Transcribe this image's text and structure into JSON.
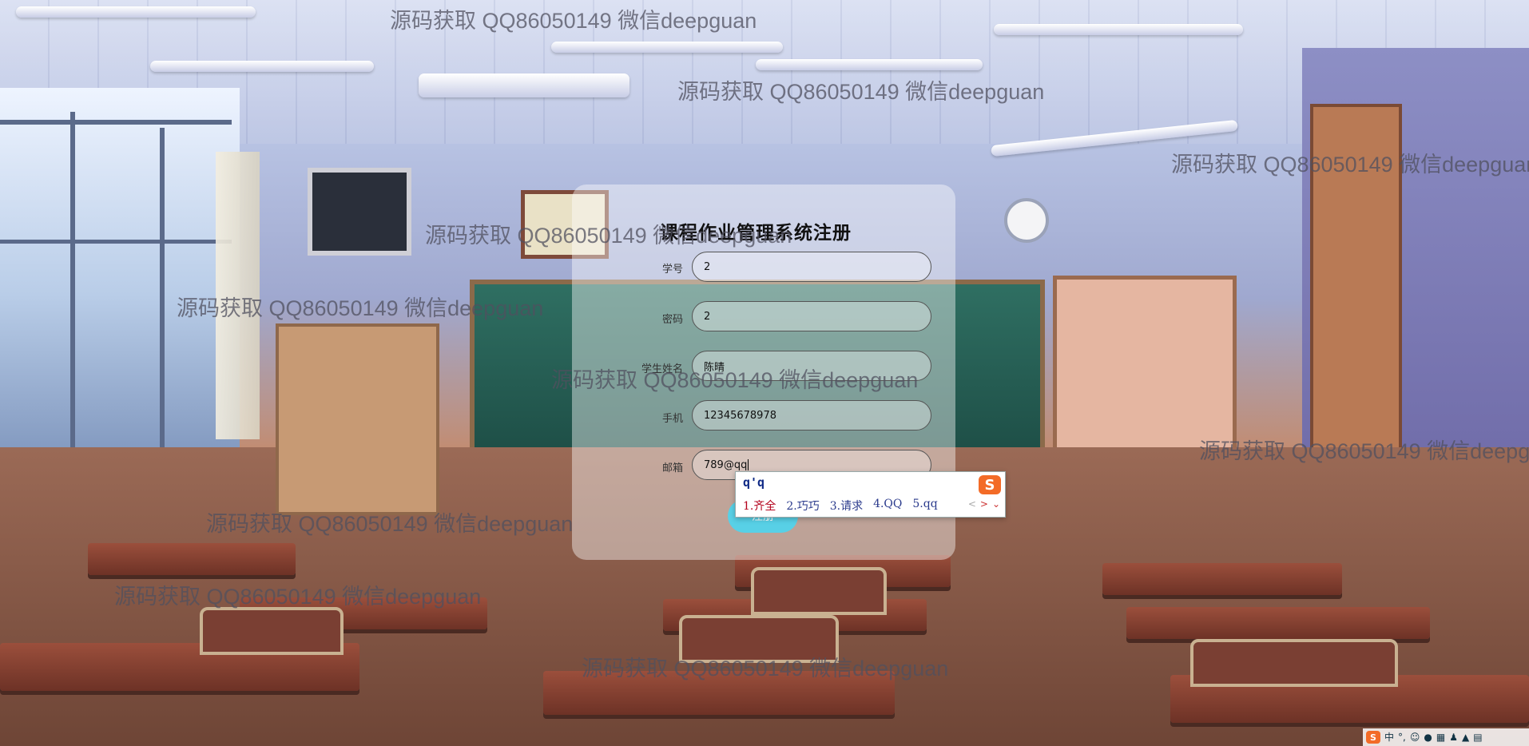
{
  "form": {
    "title": "课程作业管理系统注册",
    "fields": [
      {
        "label": "学号",
        "value": "2"
      },
      {
        "label": "密码",
        "value": "2"
      },
      {
        "label": "学生姓名",
        "value": "陈晴"
      },
      {
        "label": "手机",
        "value": "12345678978"
      },
      {
        "label": "邮箱",
        "value": "789@qq"
      }
    ],
    "submit_label": "注册"
  },
  "ime": {
    "composition": "q'q",
    "candidates": [
      "1.齐全",
      "2.巧巧",
      "3.请求",
      "4.QQ",
      "5.qq"
    ],
    "nav": [
      "<",
      ">",
      "⌄"
    ],
    "logo": "S"
  },
  "watermark": {
    "text": "源码获取 QQ86050149 微信deepguan"
  },
  "tray": {
    "logo": "S",
    "lang": "中",
    "icons": [
      "punct-icon",
      "emoji-icon",
      "mic-icon",
      "keyboard-icon",
      "user-icon",
      "skin-icon",
      "grid-icon"
    ]
  }
}
